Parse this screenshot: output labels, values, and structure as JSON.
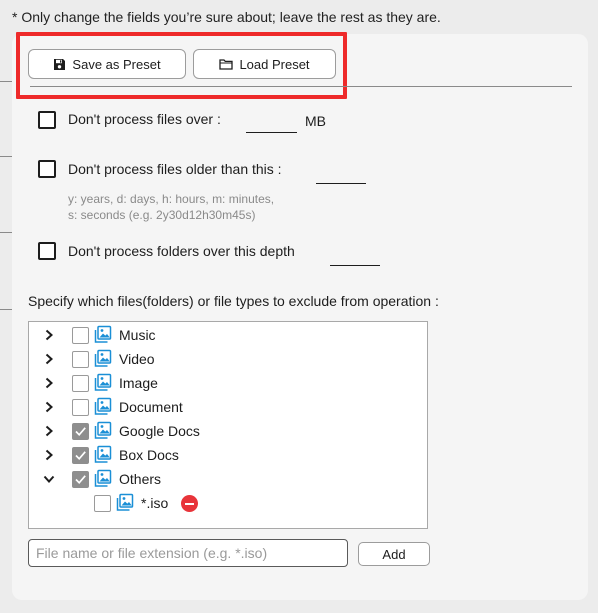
{
  "note": "* Only change the fields you’re sure about; leave the rest as they are.",
  "toolbar": {
    "save_label": "Save as Preset",
    "save_icon": "floppy-disk-icon",
    "load_label": "Load Preset",
    "load_icon": "folder-icon"
  },
  "options": {
    "size": {
      "label": "Don't process files over :",
      "value": "",
      "unit": "MB",
      "checked": false
    },
    "age": {
      "label": "Don't process files older than this :",
      "value": "",
      "checked": false,
      "hint_line1": "y: years, d: days, h: hours, m: minutes,",
      "hint_line2": "s: seconds (e.g. 2y30d12h30m45s)"
    },
    "depth": {
      "label": "Don't process folders over this depth",
      "value": "",
      "checked": false
    }
  },
  "exclude": {
    "heading": "Specify which files(folders) or file types to exclude from operation :",
    "items": [
      {
        "label": "Music",
        "checked": false,
        "expanded": false
      },
      {
        "label": "Video",
        "checked": false,
        "expanded": false
      },
      {
        "label": "Image",
        "checked": false,
        "expanded": false
      },
      {
        "label": "Document",
        "checked": false,
        "expanded": false
      },
      {
        "label": "Google Docs",
        "checked": true,
        "expanded": false
      },
      {
        "label": "Box Docs",
        "checked": true,
        "expanded": false
      },
      {
        "label": "Others",
        "checked": true,
        "expanded": true,
        "children": [
          {
            "label": "*.iso",
            "checked": false
          }
        ]
      }
    ]
  },
  "add_entry": {
    "placeholder": "File name or file extension (e.g. *.iso)",
    "value": "",
    "button_label": "Add"
  },
  "colors": {
    "highlight": "#ee2a2a",
    "image_icon": "#1a8fd6",
    "remove": "#e8343a",
    "checked_box": "#8e8e8e"
  }
}
